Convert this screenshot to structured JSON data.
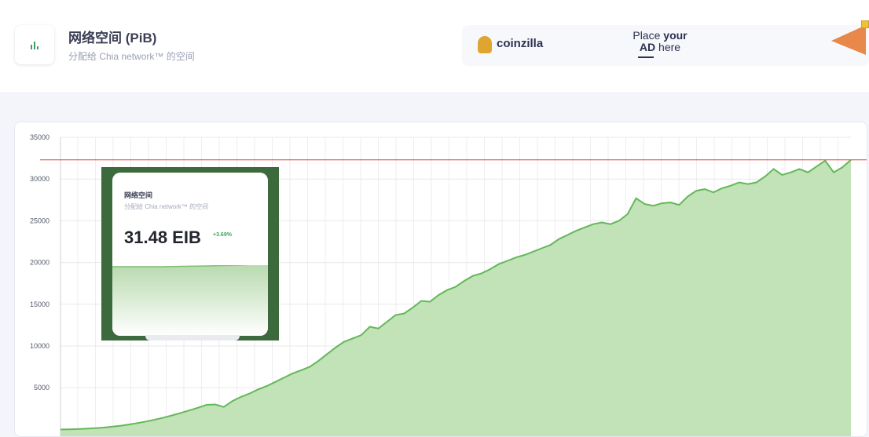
{
  "header": {
    "title": "网络空间 (PiB)",
    "subtitle": "分配给 Chia network™ 的空间",
    "icon": "bar-chart-icon"
  },
  "ad": {
    "brand": "coinzilla",
    "place_line1_a": "Place ",
    "place_line1_b": "your",
    "place_line2_a": "AD",
    "place_line2_b": " here",
    "logo_icon": "coinzilla-logo-icon"
  },
  "inset": {
    "title": "网络空间",
    "subtitle": "分配给 Chia network™ 的空间",
    "value": "31.48 EIB",
    "change": "+3.69%"
  },
  "colors": {
    "accent": "#38a169",
    "area_fill": "#bfe0b4",
    "area_line": "#63b858",
    "reference_line": "#d9443a"
  },
  "chart_data": {
    "type": "area",
    "ylim": [
      0,
      35000
    ],
    "yticks": [
      5000,
      10000,
      15000,
      20000,
      25000,
      30000,
      35000
    ],
    "ytick_labels": [
      "5000",
      "10000",
      "15000",
      "20000",
      "25000",
      "30000",
      "35000"
    ],
    "grid": true,
    "reference_line": 32300,
    "series": [
      {
        "values": [
          0,
          20,
          50,
          90,
          150,
          230,
          330,
          450,
          600,
          770,
          960,
          1180,
          1420,
          1690,
          1980,
          2280,
          2600,
          2950,
          3000,
          2700,
          3400,
          3900,
          4300,
          4800,
          5200,
          5700,
          6200,
          6700,
          7100,
          7500,
          8200,
          9000,
          9800,
          10500,
          10900,
          11300,
          12300,
          12100,
          12900,
          13700,
          13900,
          14600,
          15400,
          15300,
          16100,
          16700,
          17100,
          17800,
          18400,
          18700,
          19200,
          19800,
          20200,
          20600,
          20900,
          21300,
          21700,
          22100,
          22800,
          23300,
          23800,
          24200,
          24600,
          24800,
          24600,
          25000,
          25800,
          27700,
          27000,
          26800,
          27100,
          27200,
          26900,
          27900,
          28600,
          28800,
          28400,
          28900,
          29200,
          29600,
          29400,
          29600,
          30300,
          31200,
          30500,
          30800,
          31200,
          30800,
          31500,
          32200,
          30800,
          31400,
          32300
        ]
      }
    ]
  }
}
